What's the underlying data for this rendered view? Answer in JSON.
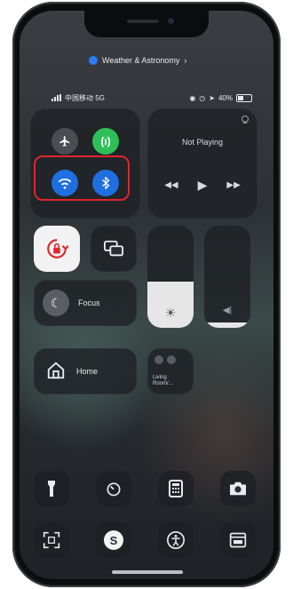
{
  "location_indicator": {
    "label": "Weather & Astronomy"
  },
  "status_bar": {
    "carrier": "中国移动 5G",
    "battery": "40%"
  },
  "connectivity": {
    "airplane": {
      "icon": "airplane-icon",
      "state": "off"
    },
    "cellular": {
      "icon": "cellular-antenna-icon",
      "state": "on",
      "color": "#2fbf59"
    },
    "wifi": {
      "icon": "wifi-icon",
      "state": "on",
      "color": "#1f6fe0"
    },
    "bluetooth": {
      "icon": "bluetooth-icon",
      "state": "on",
      "color": "#1f6fe0"
    }
  },
  "now_playing": {
    "title": "Not Playing"
  },
  "focus": {
    "label": "Focus"
  },
  "home": {
    "label": "Home"
  },
  "living_room": {
    "label_line1": "Living",
    "label_line2": "Room/...",
    "icon": "scene-icon"
  },
  "brightness": {
    "level_fraction": 0.45
  },
  "volume": {
    "level_fraction": 0.05
  },
  "bottom_row_1": [
    "flashlight-icon",
    "timer-icon",
    "calculator-icon",
    "camera-icon"
  ],
  "bottom_row_2": [
    "code-scanner-icon",
    "shazam-icon",
    "accessibility-icon",
    "screen-time-icon"
  ],
  "highlight_color": "#e0252f"
}
